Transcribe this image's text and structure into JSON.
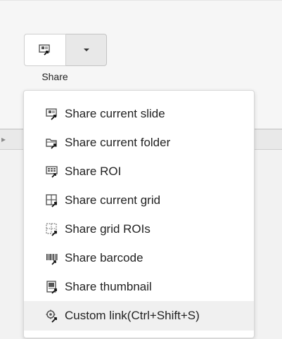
{
  "toolbar": {
    "share_label": "Share",
    "share_icon": "share-slide-icon",
    "caret_icon": "chevron-down-icon"
  },
  "menu": {
    "items": [
      {
        "label": "Share current slide",
        "icon": "share-slide-icon"
      },
      {
        "label": "Share current folder",
        "icon": "share-folder-icon"
      },
      {
        "label": "Share ROI",
        "icon": "share-roi-icon"
      },
      {
        "label": "Share current grid",
        "icon": "share-grid-icon"
      },
      {
        "label": "Share grid ROIs",
        "icon": "share-grid-rois-icon"
      },
      {
        "label": "Share barcode",
        "icon": "share-barcode-icon"
      },
      {
        "label": "Share thumbnail",
        "icon": "share-thumbnail-icon"
      },
      {
        "label": "Custom link(Ctrl+Shift+S)",
        "icon": "custom-link-icon"
      }
    ]
  },
  "colors": {
    "background": "#f6f6f6",
    "menu_bg": "#ffffff",
    "menu_hover": "#f0f0f0",
    "text": "#222222",
    "icon": "#555555"
  }
}
